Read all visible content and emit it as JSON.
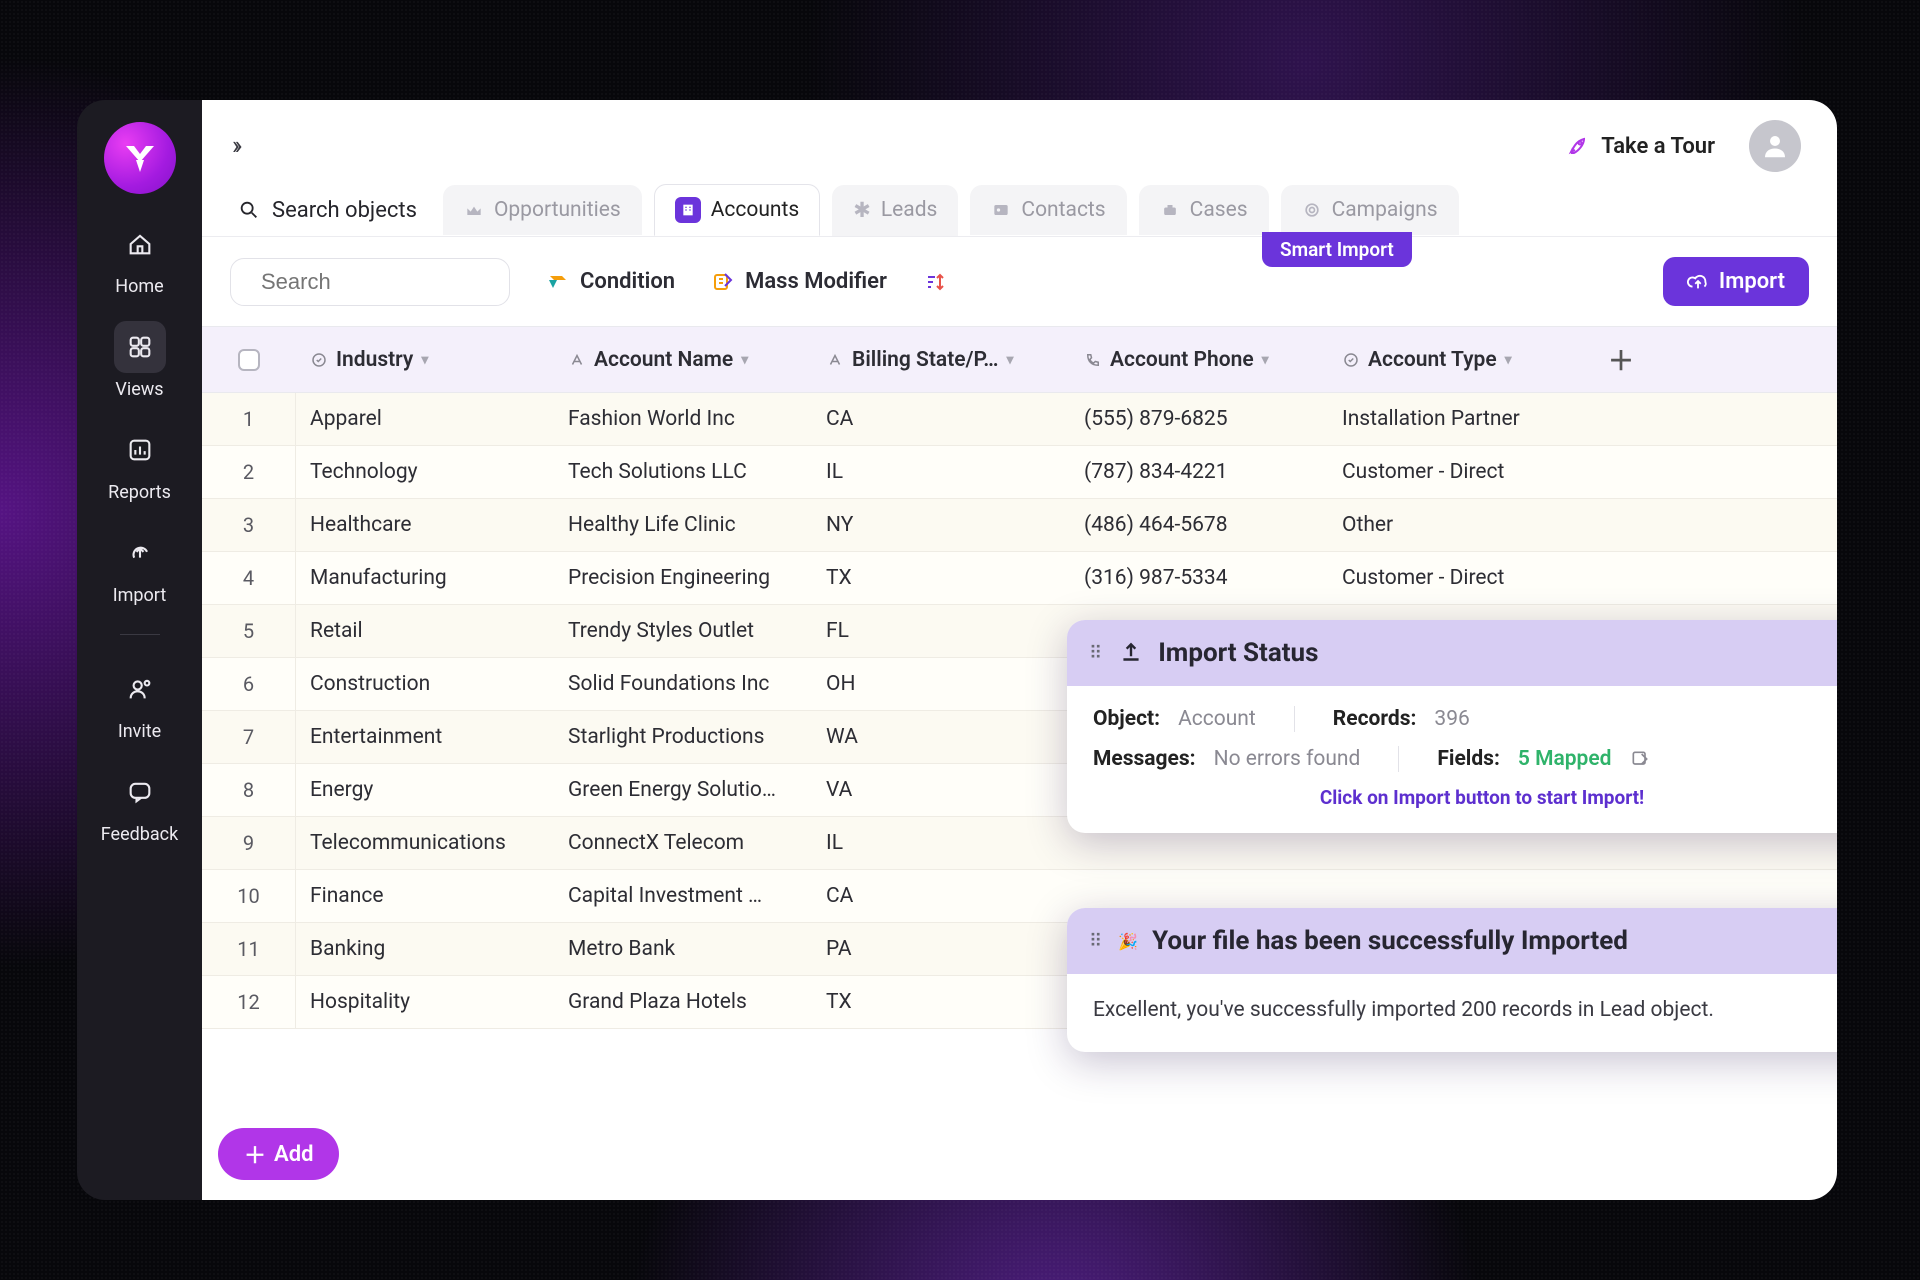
{
  "sidebar": {
    "items": [
      {
        "label": "Home"
      },
      {
        "label": "Views"
      },
      {
        "label": "Reports"
      },
      {
        "label": "Import"
      },
      {
        "label": "Invite"
      },
      {
        "label": "Feedback"
      }
    ]
  },
  "topbar": {
    "tour": "Take a Tour"
  },
  "tabs": {
    "search_label": "Search objects",
    "items": [
      {
        "label": "Opportunities"
      },
      {
        "label": "Accounts"
      },
      {
        "label": "Leads"
      },
      {
        "label": "Contacts"
      },
      {
        "label": "Cases"
      },
      {
        "label": "Campaigns"
      }
    ],
    "smart_badge": "Smart Import"
  },
  "toolbar": {
    "search_placeholder": "Search",
    "condition": "Condition",
    "mass_modifier": "Mass Modifier",
    "import": "Import"
  },
  "columns": [
    "Industry",
    "Account Name",
    "Billing State/P…",
    "Account Phone",
    "Account Type"
  ],
  "rows": [
    {
      "n": "1",
      "industry": "Apparel",
      "account": "Fashion World Inc",
      "state": "CA",
      "phone": "(555) 879-6825",
      "type": "Installation Partner"
    },
    {
      "n": "2",
      "industry": "Technology",
      "account": "Tech Solutions LLC",
      "state": "IL",
      "phone": "(787) 834-4221",
      "type": "Customer - Direct"
    },
    {
      "n": "3",
      "industry": "Healthcare",
      "account": "Healthy Life Clinic",
      "state": "NY",
      "phone": "(486) 464-5678",
      "type": "Other"
    },
    {
      "n": "4",
      "industry": "Manufacturing",
      "account": "Precision Engineering",
      "state": "TX",
      "phone": "(316) 987-5334",
      "type": "Customer - Direct"
    },
    {
      "n": "5",
      "industry": "Retail",
      "account": "Trendy Styles Outlet",
      "state": "FL",
      "phone": "",
      "type": ""
    },
    {
      "n": "6",
      "industry": "Construction",
      "account": "Solid Foundations Inc",
      "state": "OH",
      "phone": "",
      "type": ""
    },
    {
      "n": "7",
      "industry": "Entertainment",
      "account": "Starlight Productions",
      "state": "WA",
      "phone": "",
      "type": ""
    },
    {
      "n": "8",
      "industry": "Energy",
      "account": "Green Energy Solutio…",
      "state": "VA",
      "phone": "",
      "type": ""
    },
    {
      "n": "9",
      "industry": "Telecommunications",
      "account": "ConnectX Telecom",
      "state": "IL",
      "phone": "",
      "type": ""
    },
    {
      "n": "10",
      "industry": "Finance",
      "account": "Capital Investment …",
      "state": "CA",
      "phone": "",
      "type": ""
    },
    {
      "n": "11",
      "industry": "Banking",
      "account": "Metro Bank",
      "state": "PA",
      "phone": "",
      "type": ""
    },
    {
      "n": "12",
      "industry": "Hospitality",
      "account": "Grand Plaza Hotels",
      "state": "TX",
      "phone": "",
      "type": ""
    }
  ],
  "add_button": "Add",
  "import_status": {
    "title": "Import Status",
    "object_label": "Object:",
    "object_value": "Account",
    "records_label": "Records:",
    "records_value": "396",
    "messages_label": "Messages:",
    "messages_value": "No errors found",
    "fields_label": "Fields:",
    "fields_value": "5 Mapped",
    "cta": "Click on Import button to start Import!"
  },
  "success_toast": {
    "title": "Your file has been successfully Imported",
    "body": "Excellent, you've successfully imported 200 records in Lead object."
  }
}
